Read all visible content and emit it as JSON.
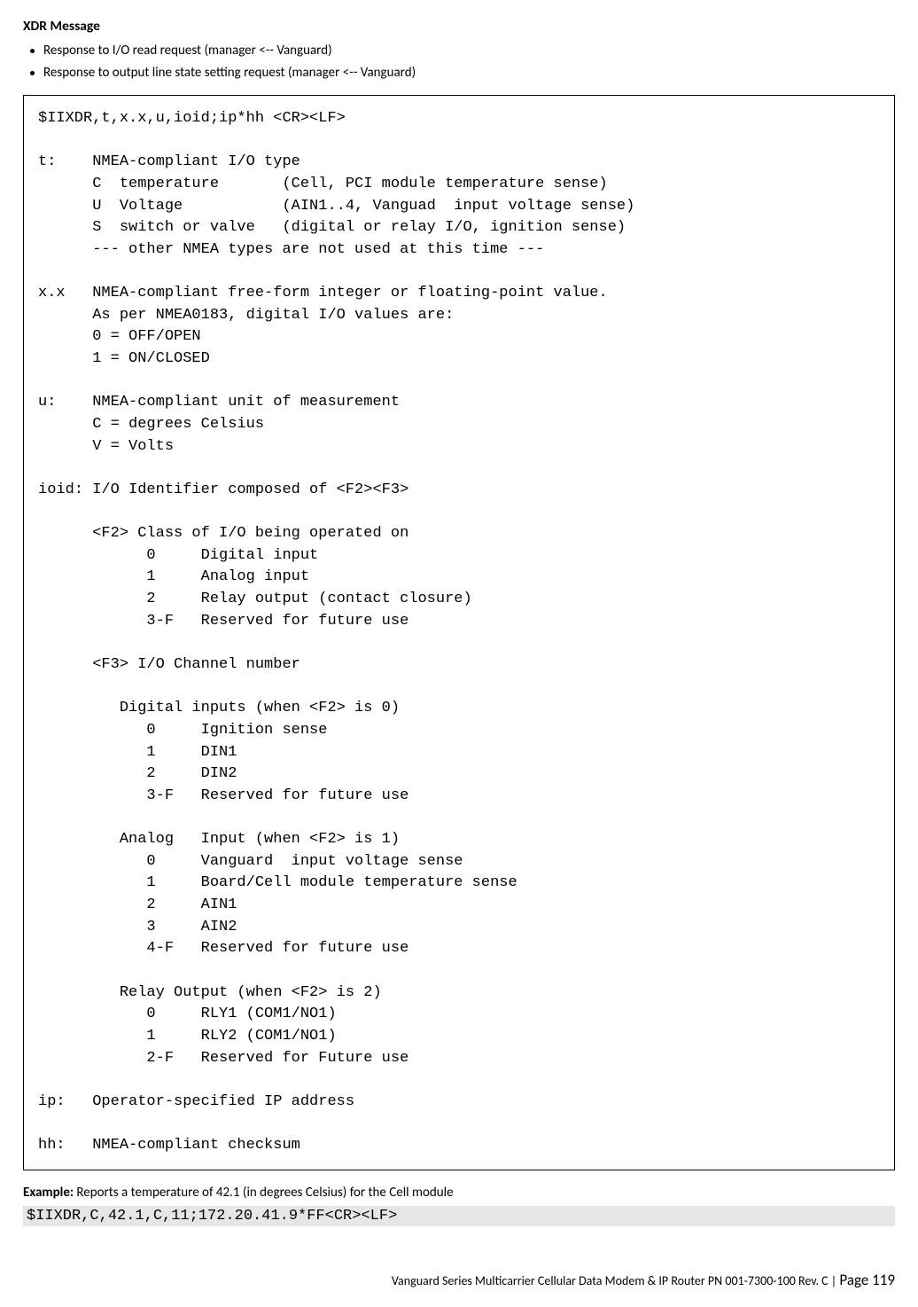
{
  "title": "XDR Message",
  "bullets": [
    "Response to I/O read request (manager <-- Vanguard)",
    "Response to output line state setting request (manager <-- Vanguard)"
  ],
  "codebox": "$IIXDR,t,x.x,u,ioid;ip*hh <CR><LF>\n\nt:    NMEA-compliant I/O type\n      C  temperature       (Cell, PCI module temperature sense)\n      U  Voltage           (AIN1..4, Vanguad  input voltage sense)\n      S  switch or valve   (digital or relay I/O, ignition sense)\n      --- other NMEA types are not used at this time ---\n\nx.x   NMEA-compliant free-form integer or floating-point value.\n      As per NMEA0183, digital I/O values are:\n      0 = OFF/OPEN\n      1 = ON/CLOSED\n\nu:    NMEA-compliant unit of measurement\n      C = degrees Celsius\n      V = Volts\n\nioid: I/O Identifier composed of <F2><F3>\n\n      <F2> Class of I/O being operated on\n            0     Digital input\n            1     Analog input\n            2     Relay output (contact closure)\n            3-F   Reserved for future use\n\n      <F3> I/O Channel number\n\n         Digital inputs (when <F2> is 0)\n            0     Ignition sense\n            1     DIN1\n            2     DIN2\n            3-F   Reserved for future use\n\n         Analog   Input (when <F2> is 1)\n            0     Vanguard  input voltage sense\n            1     Board/Cell module temperature sense\n            2     AIN1\n            3     AIN2\n            4-F   Reserved for future use\n\n         Relay Output (when <F2> is 2)\n            0     RLY1 (COM1/NO1)\n            1     RLY2 (COM1/NO1)\n            2-F   Reserved for Future use\n\nip:   Operator-specified IP address\n\nhh:   NMEA-compliant checksum",
  "example": {
    "label": "Example:",
    "text": " Reports a temperature of 42.1 (in degrees Celsius) for the Cell module",
    "code": "$IIXDR,C,42.1,C,11;172.20.41.9*FF<CR><LF>"
  },
  "footer": {
    "doc": "Vanguard Series Multicarrier Cellular Data Modem & IP Router PN 001-7300-100 Rev. C",
    "sep": " | ",
    "page": "Page 119"
  }
}
